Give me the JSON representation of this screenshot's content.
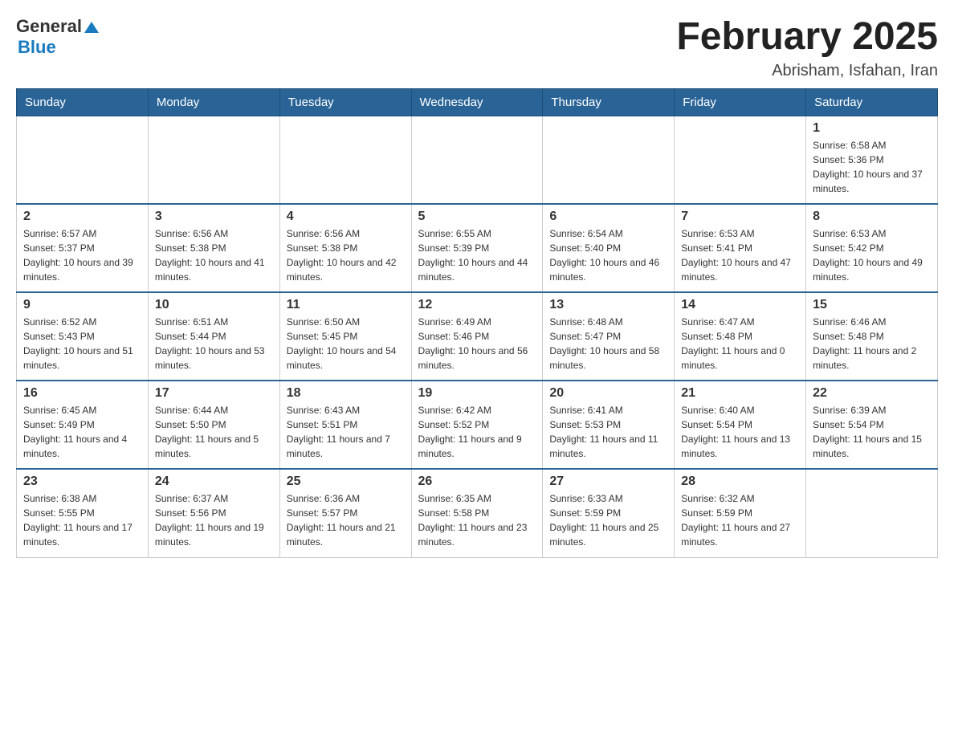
{
  "header": {
    "logo_general": "General",
    "logo_blue": "Blue",
    "month_title": "February 2025",
    "location": "Abrisham, Isfahan, Iran"
  },
  "days_of_week": [
    "Sunday",
    "Monday",
    "Tuesday",
    "Wednesday",
    "Thursday",
    "Friday",
    "Saturday"
  ],
  "weeks": [
    {
      "days": [
        {
          "number": "",
          "sunrise": "",
          "sunset": "",
          "daylight": ""
        },
        {
          "number": "",
          "sunrise": "",
          "sunset": "",
          "daylight": ""
        },
        {
          "number": "",
          "sunrise": "",
          "sunset": "",
          "daylight": ""
        },
        {
          "number": "",
          "sunrise": "",
          "sunset": "",
          "daylight": ""
        },
        {
          "number": "",
          "sunrise": "",
          "sunset": "",
          "daylight": ""
        },
        {
          "number": "",
          "sunrise": "",
          "sunset": "",
          "daylight": ""
        },
        {
          "number": "1",
          "sunrise": "Sunrise: 6:58 AM",
          "sunset": "Sunset: 5:36 PM",
          "daylight": "Daylight: 10 hours and 37 minutes."
        }
      ]
    },
    {
      "days": [
        {
          "number": "2",
          "sunrise": "Sunrise: 6:57 AM",
          "sunset": "Sunset: 5:37 PM",
          "daylight": "Daylight: 10 hours and 39 minutes."
        },
        {
          "number": "3",
          "sunrise": "Sunrise: 6:56 AM",
          "sunset": "Sunset: 5:38 PM",
          "daylight": "Daylight: 10 hours and 41 minutes."
        },
        {
          "number": "4",
          "sunrise": "Sunrise: 6:56 AM",
          "sunset": "Sunset: 5:38 PM",
          "daylight": "Daylight: 10 hours and 42 minutes."
        },
        {
          "number": "5",
          "sunrise": "Sunrise: 6:55 AM",
          "sunset": "Sunset: 5:39 PM",
          "daylight": "Daylight: 10 hours and 44 minutes."
        },
        {
          "number": "6",
          "sunrise": "Sunrise: 6:54 AM",
          "sunset": "Sunset: 5:40 PM",
          "daylight": "Daylight: 10 hours and 46 minutes."
        },
        {
          "number": "7",
          "sunrise": "Sunrise: 6:53 AM",
          "sunset": "Sunset: 5:41 PM",
          "daylight": "Daylight: 10 hours and 47 minutes."
        },
        {
          "number": "8",
          "sunrise": "Sunrise: 6:53 AM",
          "sunset": "Sunset: 5:42 PM",
          "daylight": "Daylight: 10 hours and 49 minutes."
        }
      ]
    },
    {
      "days": [
        {
          "number": "9",
          "sunrise": "Sunrise: 6:52 AM",
          "sunset": "Sunset: 5:43 PM",
          "daylight": "Daylight: 10 hours and 51 minutes."
        },
        {
          "number": "10",
          "sunrise": "Sunrise: 6:51 AM",
          "sunset": "Sunset: 5:44 PM",
          "daylight": "Daylight: 10 hours and 53 minutes."
        },
        {
          "number": "11",
          "sunrise": "Sunrise: 6:50 AM",
          "sunset": "Sunset: 5:45 PM",
          "daylight": "Daylight: 10 hours and 54 minutes."
        },
        {
          "number": "12",
          "sunrise": "Sunrise: 6:49 AM",
          "sunset": "Sunset: 5:46 PM",
          "daylight": "Daylight: 10 hours and 56 minutes."
        },
        {
          "number": "13",
          "sunrise": "Sunrise: 6:48 AM",
          "sunset": "Sunset: 5:47 PM",
          "daylight": "Daylight: 10 hours and 58 minutes."
        },
        {
          "number": "14",
          "sunrise": "Sunrise: 6:47 AM",
          "sunset": "Sunset: 5:48 PM",
          "daylight": "Daylight: 11 hours and 0 minutes."
        },
        {
          "number": "15",
          "sunrise": "Sunrise: 6:46 AM",
          "sunset": "Sunset: 5:48 PM",
          "daylight": "Daylight: 11 hours and 2 minutes."
        }
      ]
    },
    {
      "days": [
        {
          "number": "16",
          "sunrise": "Sunrise: 6:45 AM",
          "sunset": "Sunset: 5:49 PM",
          "daylight": "Daylight: 11 hours and 4 minutes."
        },
        {
          "number": "17",
          "sunrise": "Sunrise: 6:44 AM",
          "sunset": "Sunset: 5:50 PM",
          "daylight": "Daylight: 11 hours and 5 minutes."
        },
        {
          "number": "18",
          "sunrise": "Sunrise: 6:43 AM",
          "sunset": "Sunset: 5:51 PM",
          "daylight": "Daylight: 11 hours and 7 minutes."
        },
        {
          "number": "19",
          "sunrise": "Sunrise: 6:42 AM",
          "sunset": "Sunset: 5:52 PM",
          "daylight": "Daylight: 11 hours and 9 minutes."
        },
        {
          "number": "20",
          "sunrise": "Sunrise: 6:41 AM",
          "sunset": "Sunset: 5:53 PM",
          "daylight": "Daylight: 11 hours and 11 minutes."
        },
        {
          "number": "21",
          "sunrise": "Sunrise: 6:40 AM",
          "sunset": "Sunset: 5:54 PM",
          "daylight": "Daylight: 11 hours and 13 minutes."
        },
        {
          "number": "22",
          "sunrise": "Sunrise: 6:39 AM",
          "sunset": "Sunset: 5:54 PM",
          "daylight": "Daylight: 11 hours and 15 minutes."
        }
      ]
    },
    {
      "days": [
        {
          "number": "23",
          "sunrise": "Sunrise: 6:38 AM",
          "sunset": "Sunset: 5:55 PM",
          "daylight": "Daylight: 11 hours and 17 minutes."
        },
        {
          "number": "24",
          "sunrise": "Sunrise: 6:37 AM",
          "sunset": "Sunset: 5:56 PM",
          "daylight": "Daylight: 11 hours and 19 minutes."
        },
        {
          "number": "25",
          "sunrise": "Sunrise: 6:36 AM",
          "sunset": "Sunset: 5:57 PM",
          "daylight": "Daylight: 11 hours and 21 minutes."
        },
        {
          "number": "26",
          "sunrise": "Sunrise: 6:35 AM",
          "sunset": "Sunset: 5:58 PM",
          "daylight": "Daylight: 11 hours and 23 minutes."
        },
        {
          "number": "27",
          "sunrise": "Sunrise: 6:33 AM",
          "sunset": "Sunset: 5:59 PM",
          "daylight": "Daylight: 11 hours and 25 minutes."
        },
        {
          "number": "28",
          "sunrise": "Sunrise: 6:32 AM",
          "sunset": "Sunset: 5:59 PM",
          "daylight": "Daylight: 11 hours and 27 minutes."
        },
        {
          "number": "",
          "sunrise": "",
          "sunset": "",
          "daylight": ""
        }
      ]
    }
  ]
}
